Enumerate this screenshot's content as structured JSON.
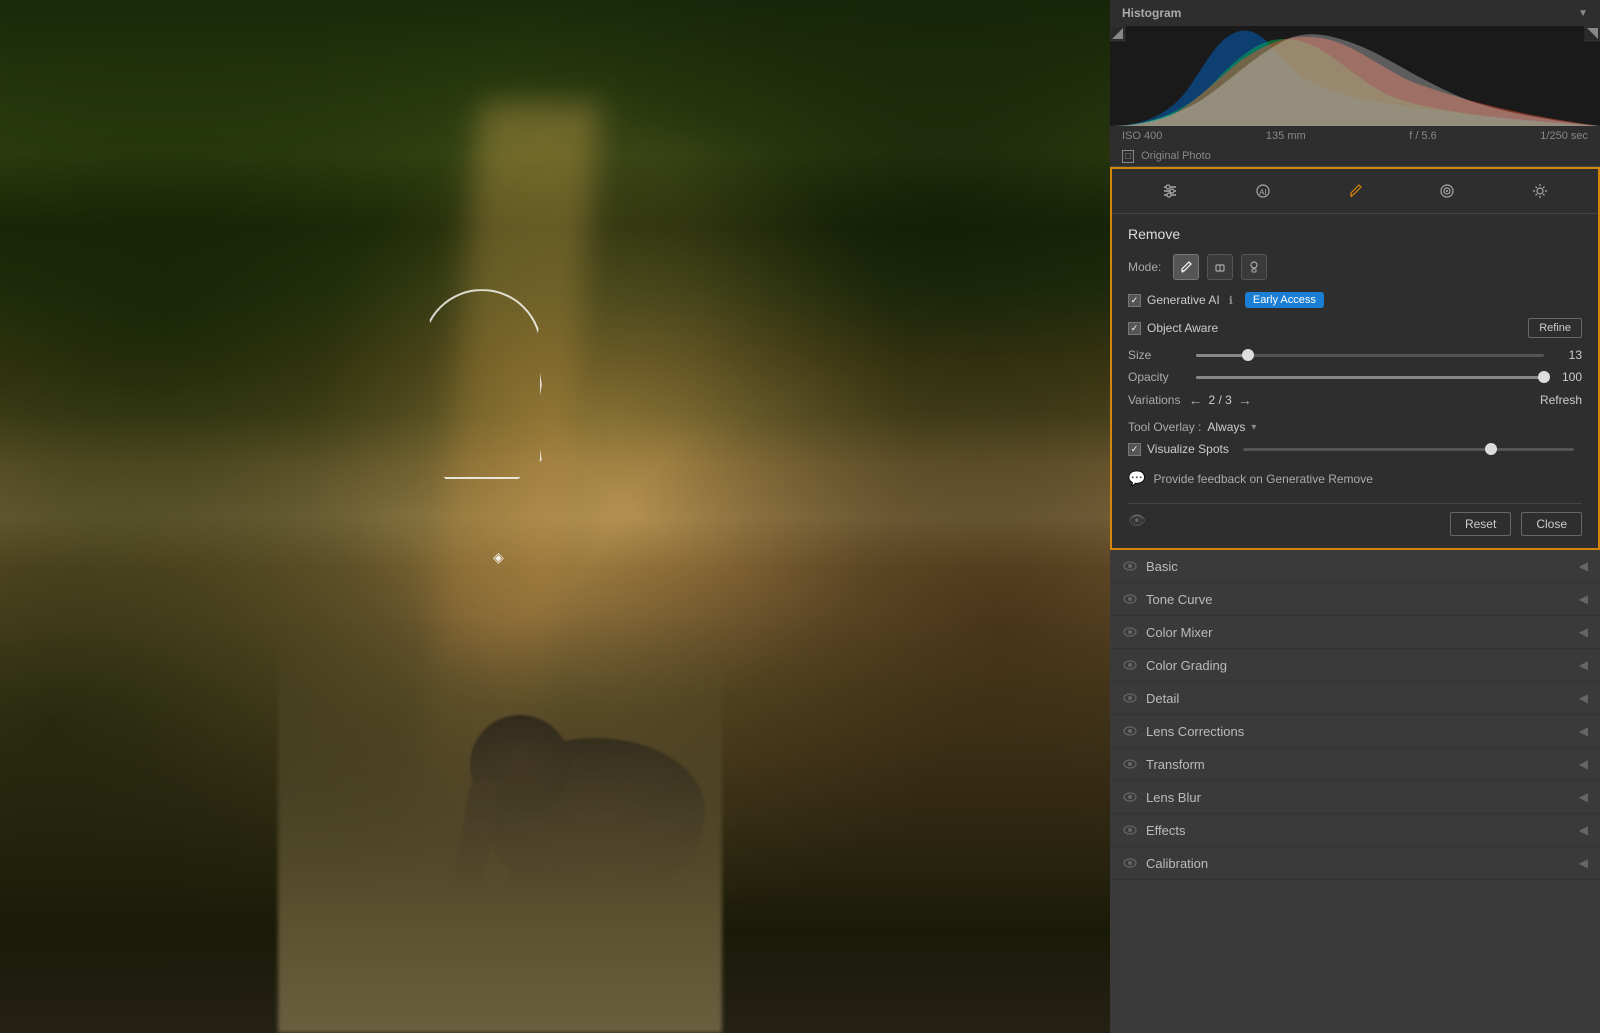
{
  "histogram": {
    "title": "Histogram",
    "info": {
      "iso": "ISO 400",
      "focal": "135 mm",
      "aperture": "f / 5.6",
      "shutter": "1/250 sec"
    },
    "original_photo_label": "Original Photo"
  },
  "toolbar": {
    "icons": [
      "adjust-icon",
      "ai-icon",
      "brush-icon",
      "target-icon",
      "settings-icon"
    ]
  },
  "remove_panel": {
    "title": "Remove",
    "mode_label": "Mode:",
    "modes": [
      "brush-mode",
      "eraser-mode",
      "stamp-mode"
    ],
    "generative_ai_label": "Generative AI",
    "early_access_badge": "Early Access",
    "object_aware_label": "Object Aware",
    "refine_btn": "Refine",
    "size_label": "Size",
    "size_value": "13",
    "size_percent": 15,
    "opacity_label": "Opacity",
    "opacity_value": "100",
    "opacity_percent": 100,
    "variations_label": "Variations",
    "variations_count": "2 / 3",
    "refresh_btn": "Refresh",
    "tool_overlay_label": "Tool Overlay :",
    "tool_overlay_value": "Always",
    "visualize_spots_label": "Visualize Spots",
    "feedback_label": "Provide feedback on Generative Remove",
    "reset_btn": "Reset",
    "close_btn": "Close"
  },
  "panel_items": [
    {
      "label": "Basic",
      "id": "basic"
    },
    {
      "label": "Tone Curve",
      "id": "tone-curve"
    },
    {
      "label": "Color Mixer",
      "id": "color-mixer"
    },
    {
      "label": "Color Grading",
      "id": "color-grading"
    },
    {
      "label": "Detail",
      "id": "detail"
    },
    {
      "label": "Lens Corrections",
      "id": "lens-corrections"
    },
    {
      "label": "Transform",
      "id": "transform"
    },
    {
      "label": "Lens Blur",
      "id": "lens-blur"
    },
    {
      "label": "Effects",
      "id": "effects"
    },
    {
      "label": "Calibration",
      "id": "calibration"
    }
  ]
}
